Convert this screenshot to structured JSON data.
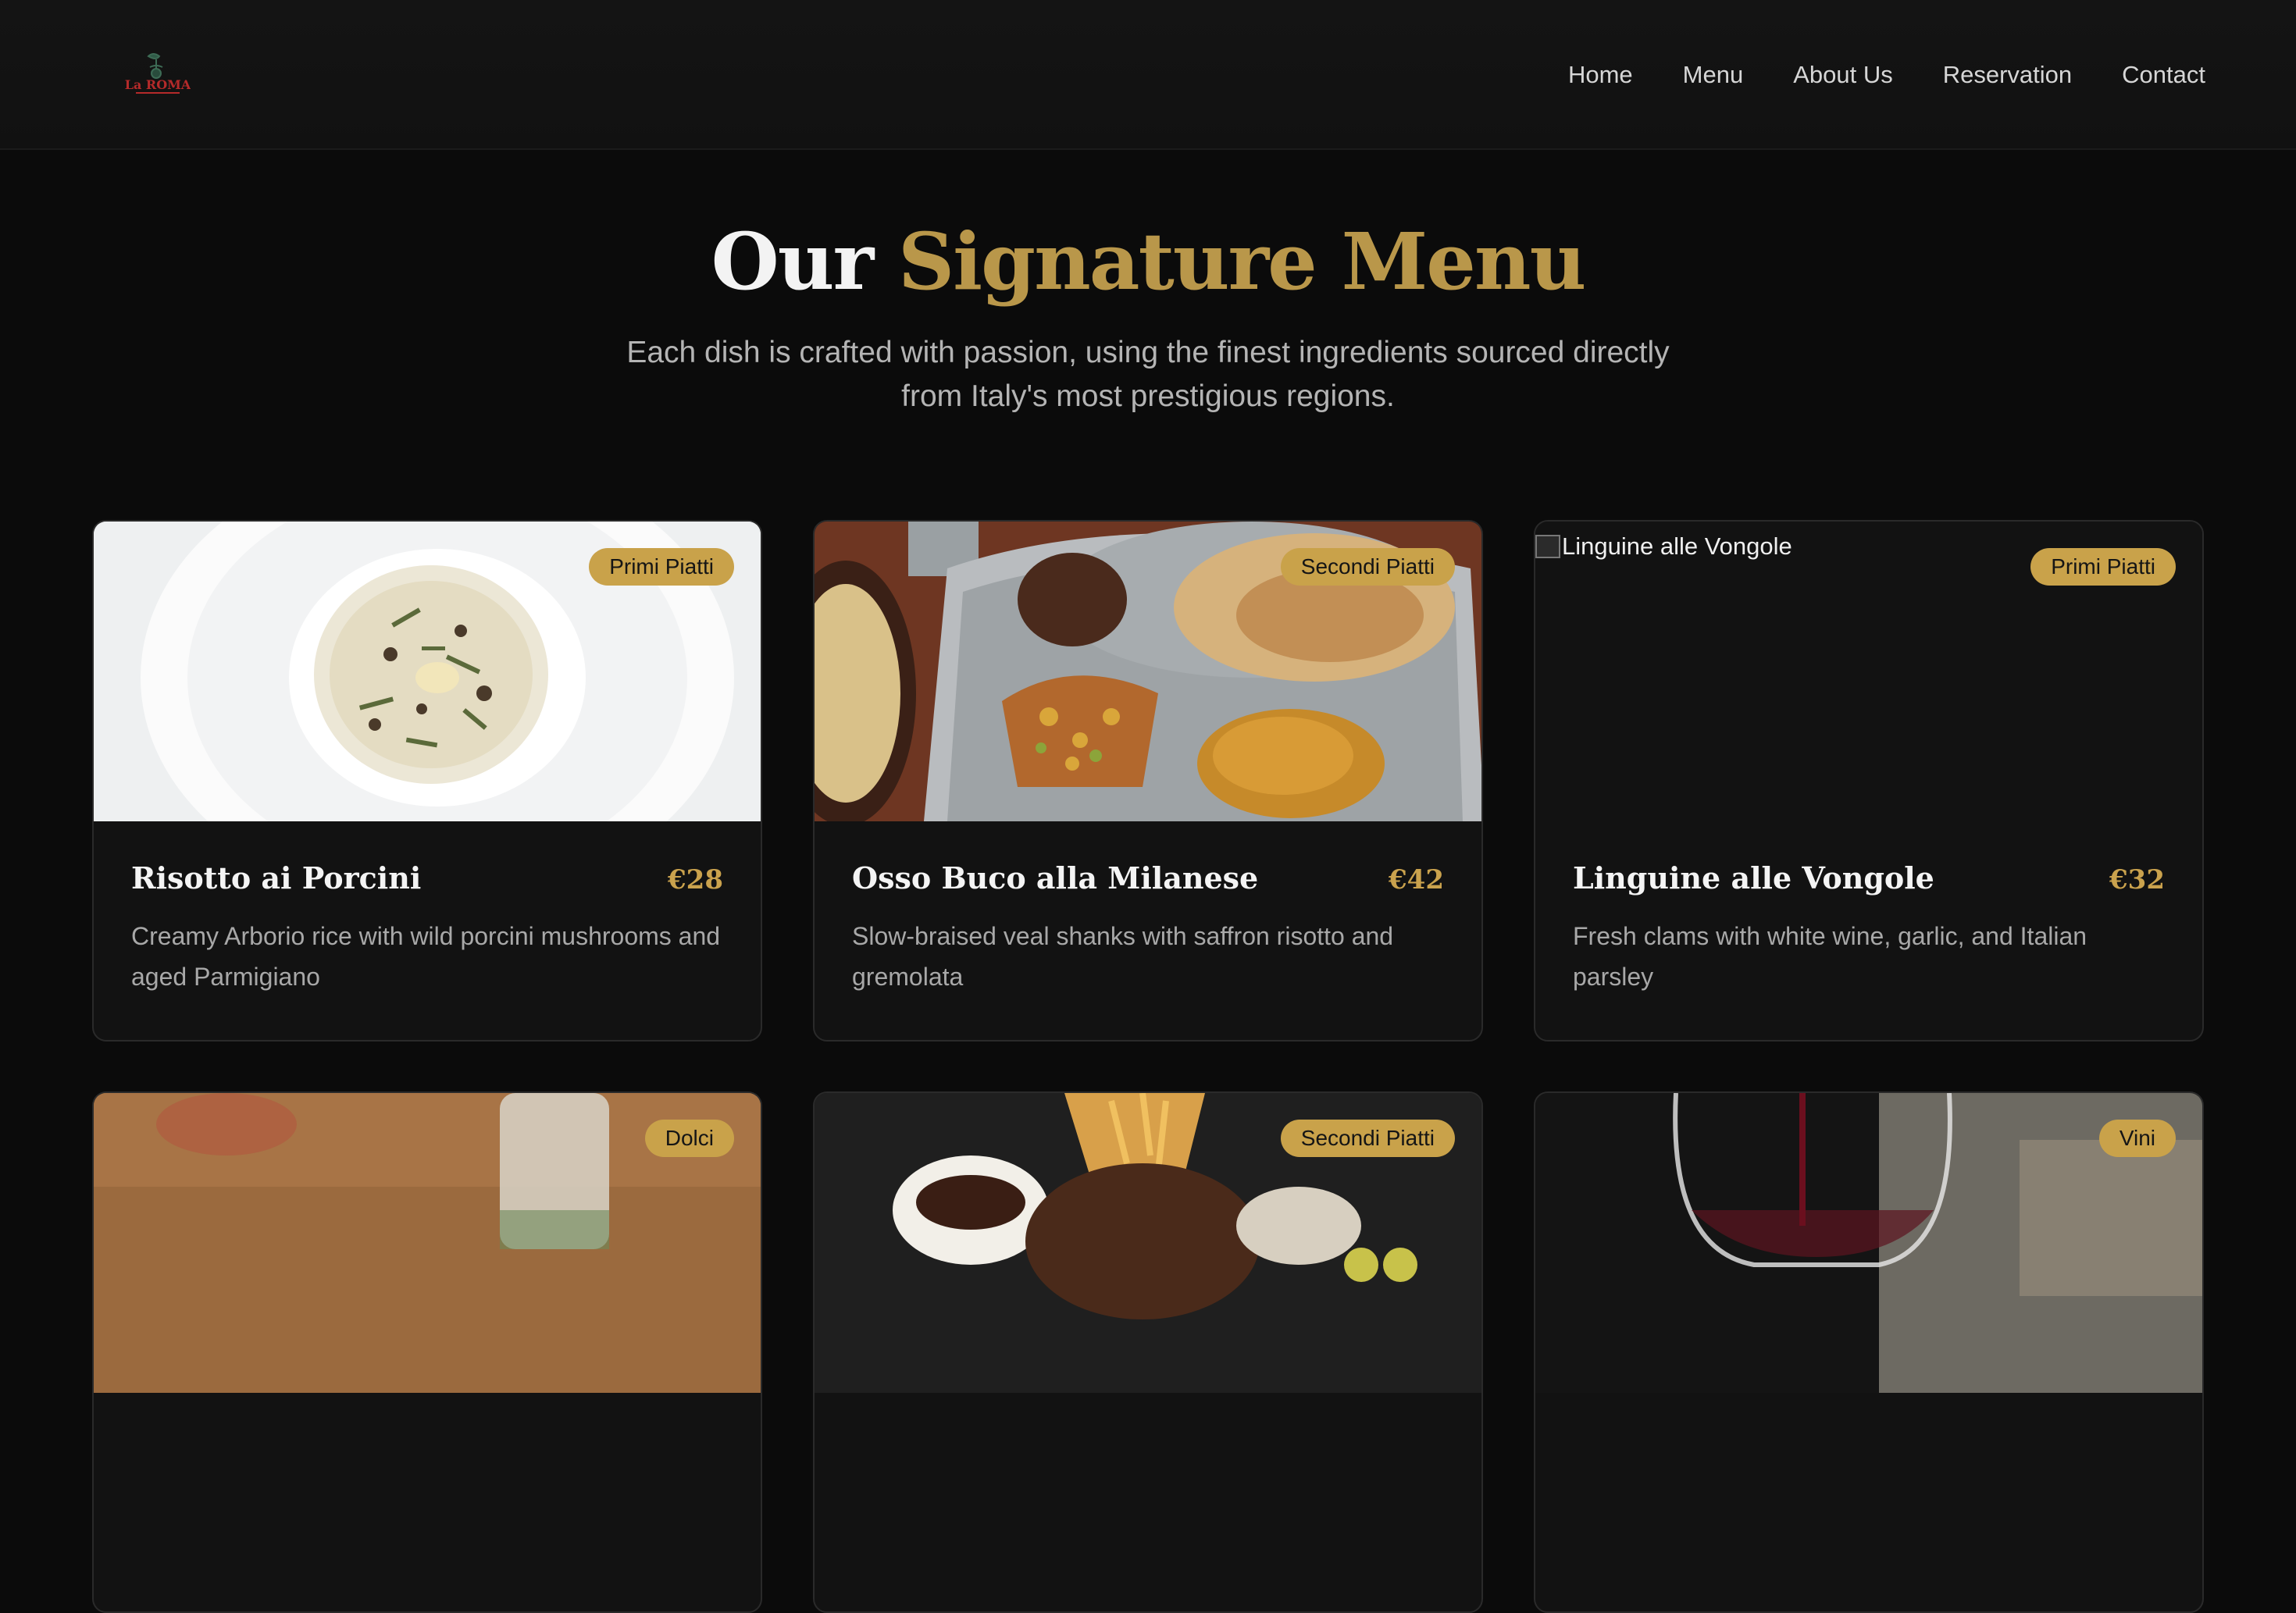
{
  "nav": {
    "logo_text": "La ROMA",
    "links": [
      "Home",
      "Menu",
      "About Us",
      "Reservation",
      "Contact"
    ]
  },
  "hero": {
    "title_plain": "Our",
    "title_accent": "Signature Menu",
    "subtitle": "Each dish is crafted with passion, using the finest ingredients sourced directly from Italy's most prestigious regions."
  },
  "colors": {
    "accent": "#caa24d",
    "background": "#0b0b0b",
    "card": "#121212"
  },
  "menu": {
    "items": [
      {
        "category": "Primi Piatti",
        "name": "Risotto ai Porcini",
        "price": "€28",
        "description": "Creamy Arborio rice with wild porcini mushrooms and aged Parmigiano"
      },
      {
        "category": "Secondi Piatti",
        "name": "Osso Buco alla Milanese",
        "price": "€42",
        "description": "Slow-braised veal shanks with saffron risotto and gremolata"
      },
      {
        "category": "Primi Piatti",
        "name": "Linguine alle Vongole",
        "price": "€32",
        "description": "Fresh clams with white wine, garlic, and Italian parsley",
        "image_alt": "Linguine alle Vongole"
      },
      {
        "category": "Dolci"
      },
      {
        "category": "Secondi Piatti"
      },
      {
        "category": "Vini"
      }
    ]
  }
}
